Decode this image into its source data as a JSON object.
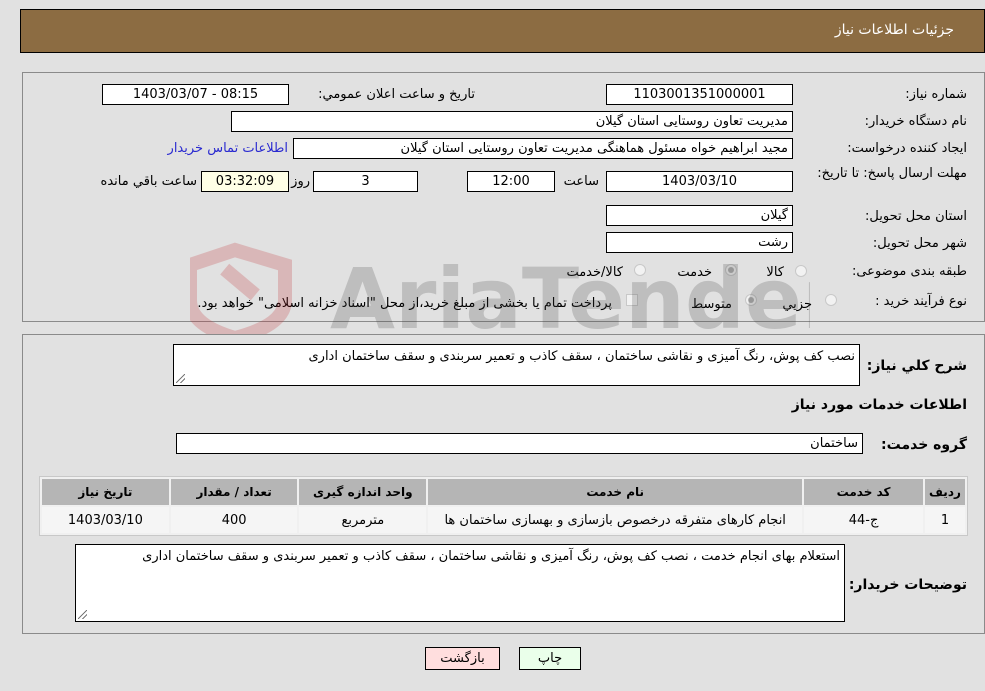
{
  "header": {
    "title": "جزئیات اطلاعات نیاز"
  },
  "form": {
    "need_number": {
      "label": "شماره نیاز:",
      "value": "1103001351000001"
    },
    "announce_datetime": {
      "label": "تاریخ و ساعت اعلان عمومي:",
      "value": "1403/03/07 - 08:15"
    },
    "buyer_org": {
      "label": "نام دستگاه خریدار:",
      "value": "مدیریت تعاون روستایی استان گیلان"
    },
    "requester": {
      "label": "ایجاد کننده درخواست:",
      "value": "مجید ابراهیم خواه مسئول هماهنگی مدیریت تعاون روستایی استان گیلان"
    },
    "buyer_contact_link": "اطلاعات تماس خریدار",
    "deadline": {
      "label": "مهلت ارسال پاسخ: تا تاریخ:",
      "date": "1403/03/10",
      "time_label": "ساعت",
      "time": "12:00",
      "days": "3",
      "days_label": "روز و",
      "remaining": "03:32:09",
      "remaining_label": "ساعت باقي مانده"
    },
    "delivery_province": {
      "label": "استان محل تحویل:",
      "value": "گیلان"
    },
    "delivery_city": {
      "label": "شهر محل تحویل:",
      "value": "رشت"
    },
    "category": {
      "label": "طبقه بندی موضوعی:",
      "options": [
        "کالا",
        "خدمت",
        "کالا/خدمت"
      ],
      "selected": "خدمت"
    },
    "purchase_process": {
      "label": "نوع فرآیند خرید :",
      "options": [
        "جزيي",
        "متوسط"
      ],
      "selected": "متوسط",
      "checkbox_label": "پرداخت تمام یا بخشی از مبلغ خرید،از محل \"اسناد خزانه اسلامی\" خواهد بود.",
      "checkbox_checked": false
    }
  },
  "details": {
    "description_label": "شرح کلي نیاز:",
    "description": "نصب کف پوش، رنگ آمیزی و نقاشی ساختمان ، سقف کاذب و تعمیر سربندی و سقف ساختمان اداری",
    "services_title": "اطلاعات خدمات مورد نیاز",
    "service_group_label": "گروه خدمت:",
    "service_group": "ساختمان",
    "table": {
      "headers": [
        "ردیف",
        "کد خدمت",
        "نام خدمت",
        "واحد اندازه گیری",
        "تعداد / مقدار",
        "تاریخ نیاز"
      ],
      "rows": [
        [
          "1",
          "ج-44",
          "انجام کارهای متفرقه درخصوص بازسازی و بهسازی ساختمان ها",
          "مترمربع",
          "400",
          "1403/03/10"
        ]
      ]
    },
    "buyer_notes_label": "توضیحات خریدار:",
    "buyer_notes": "استعلام بهای انجام خدمت ، نصب کف پوش، رنگ آمیزی و نقاشی ساختمان ، سقف کاذب و تعمیر سربندی و سقف ساختمان اداری"
  },
  "buttons": {
    "print": "چاپ",
    "back": "بازگشت"
  },
  "colors": {
    "header_bg": "#8c6c42",
    "print_bg": "#eaffea",
    "back_bg": "#ffdede",
    "link": "#2a2ad0"
  },
  "watermark": "AriaTender.neT"
}
